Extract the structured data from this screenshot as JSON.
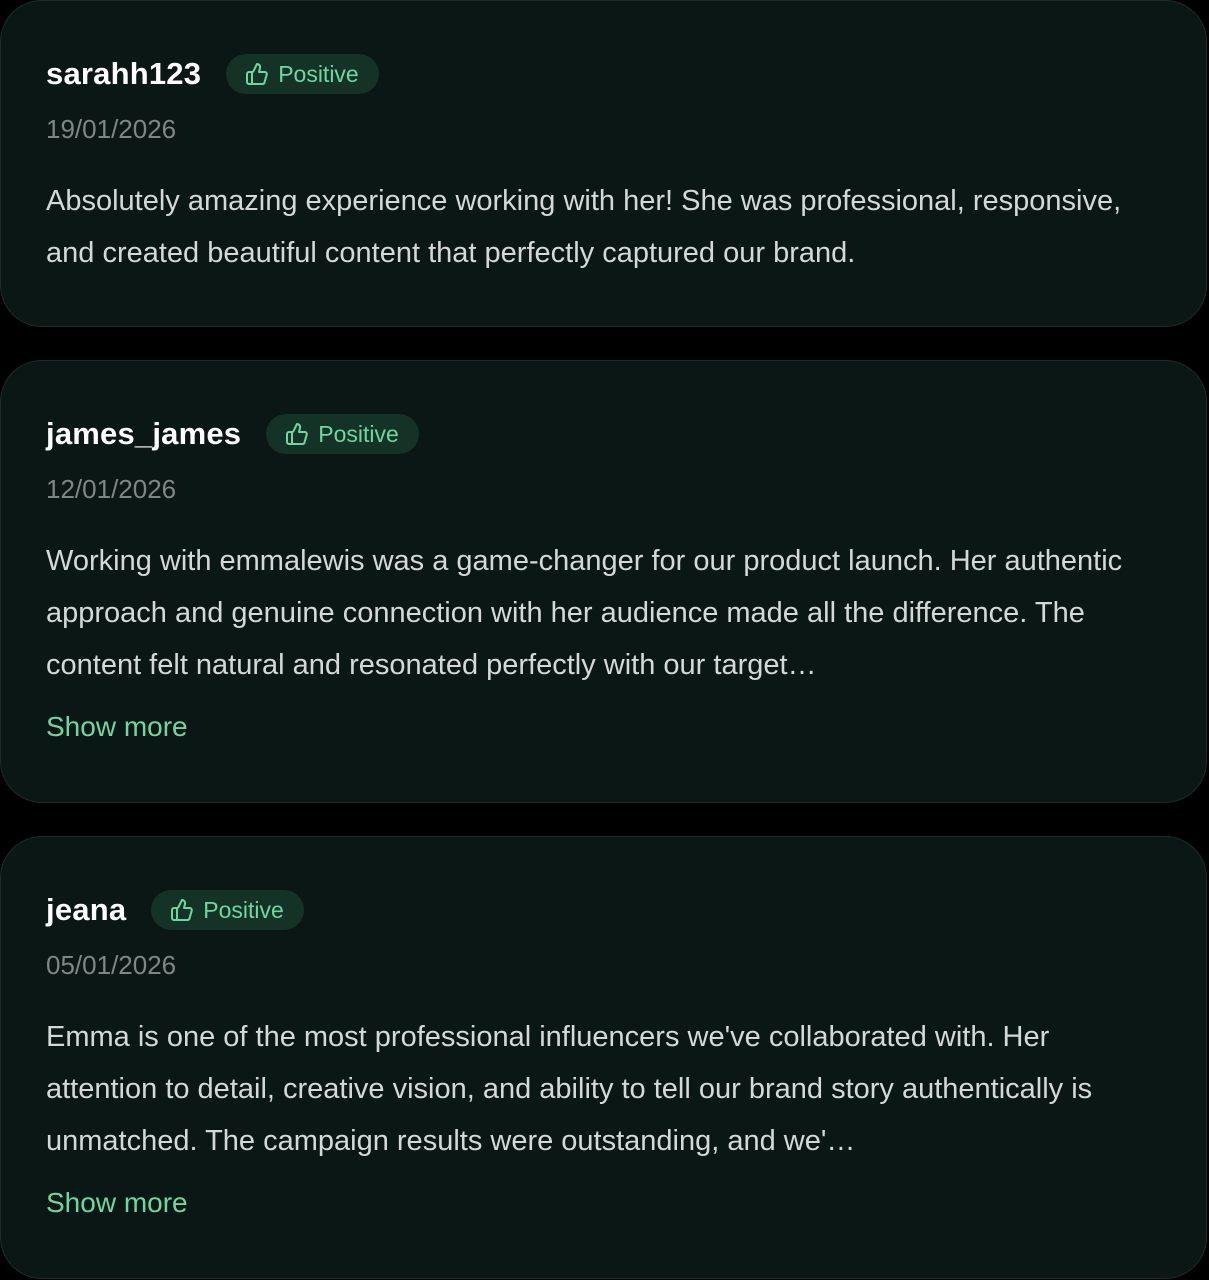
{
  "accent_color": "#6fd6a1",
  "badge_background": "#153227",
  "card_background": "#0b1714",
  "reviews": [
    {
      "username": "sarahh123",
      "sentiment": "Positive",
      "sentiment_icon": "thumbs-up-icon",
      "date": "19/01/2026",
      "text": "Absolutely amazing experience working with her! She was professional, responsive, and created beautiful content that perfectly captured our brand."
    },
    {
      "username": "james_james",
      "sentiment": "Positive",
      "sentiment_icon": "thumbs-up-icon",
      "date": "12/01/2026",
      "text": "Working with emmalewis was a game-changer for our product launch. Her authentic approach and genuine connection with her audience made all the difference. The content felt natural and resonated perfectly with our target…",
      "show_more_label": "Show more"
    },
    {
      "username": "jeana",
      "sentiment": "Positive",
      "sentiment_icon": "thumbs-up-icon",
      "date": "05/01/2026",
      "text": "Emma is one of the most professional influencers we've collaborated with. Her attention to detail, creative vision, and ability to tell our brand story authentically is unmatched. The campaign results were outstanding, and we'…",
      "show_more_label": "Show more"
    }
  ]
}
